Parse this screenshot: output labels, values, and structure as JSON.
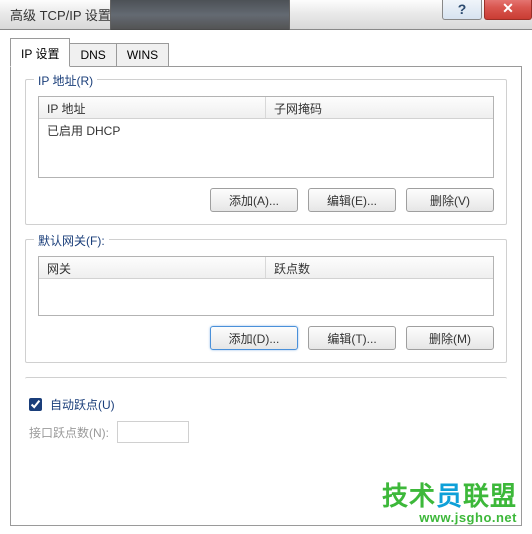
{
  "window": {
    "title": "高级 TCP/IP 设置",
    "help": "?",
    "close": "✕"
  },
  "tabs": {
    "ip": "IP 设置",
    "dns": "DNS",
    "wins": "WINS"
  },
  "ip_addresses": {
    "legend": "IP 地址(R)",
    "col_ip": "IP 地址",
    "col_mask": "子网掩码",
    "row_dhcp": "已启用 DHCP",
    "btn_add": "添加(A)...",
    "btn_edit": "编辑(E)...",
    "btn_remove": "删除(V)"
  },
  "gateways": {
    "legend": "默认网关(F):",
    "col_gw": "网关",
    "col_metric": "跃点数",
    "btn_add": "添加(D)...",
    "btn_edit": "编辑(T)...",
    "btn_remove": "删除(M)"
  },
  "metric": {
    "auto_label": "自动跃点(U)",
    "iface_label": "接口跃点数(N):",
    "value": ""
  },
  "watermark": {
    "brand": "技术员联盟",
    "url": "www.jsgho.net"
  }
}
